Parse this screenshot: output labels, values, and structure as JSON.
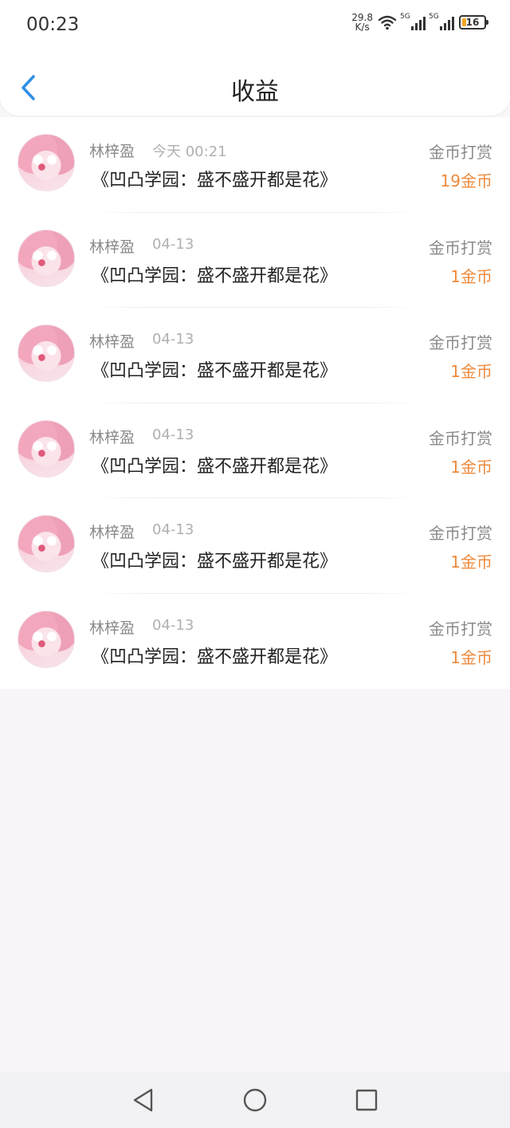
{
  "status_bar": {
    "time": "00:23",
    "net_speed_value": "29.8",
    "net_speed_unit": "K/s",
    "sim1_label": "5G",
    "sim2_label": "5G",
    "battery": "16"
  },
  "header": {
    "title": "收益",
    "back_icon": "chevron-left-icon"
  },
  "colors": {
    "accent_blue": "#2f8fe6",
    "amount_orange": "#ee8a3c"
  },
  "rows": [
    {
      "name": "林梓盈",
      "time": "今天 00:21",
      "book": "《凹凸学园：盛不盛开都是花》",
      "type": "金币打赏",
      "amount": "19金币"
    },
    {
      "name": "林梓盈",
      "time": "04-13",
      "book": "《凹凸学园：盛不盛开都是花》",
      "type": "金币打赏",
      "amount": "1金币"
    },
    {
      "name": "林梓盈",
      "time": "04-13",
      "book": "《凹凸学园：盛不盛开都是花》",
      "type": "金币打赏",
      "amount": "1金币"
    },
    {
      "name": "林梓盈",
      "time": "04-13",
      "book": "《凹凸学园：盛不盛开都是花》",
      "type": "金币打赏",
      "amount": "1金币"
    },
    {
      "name": "林梓盈",
      "time": "04-13",
      "book": "《凹凸学园：盛不盛开都是花》",
      "type": "金币打赏",
      "amount": "1金币"
    },
    {
      "name": "林梓盈",
      "time": "04-13",
      "book": "《凹凸学园：盛不盛开都是花》",
      "type": "金币打赏",
      "amount": "1金币"
    }
  ],
  "navbar": {
    "back_icon": "triangle-back-icon",
    "home_icon": "circle-home-icon",
    "recents_icon": "square-recents-icon"
  }
}
